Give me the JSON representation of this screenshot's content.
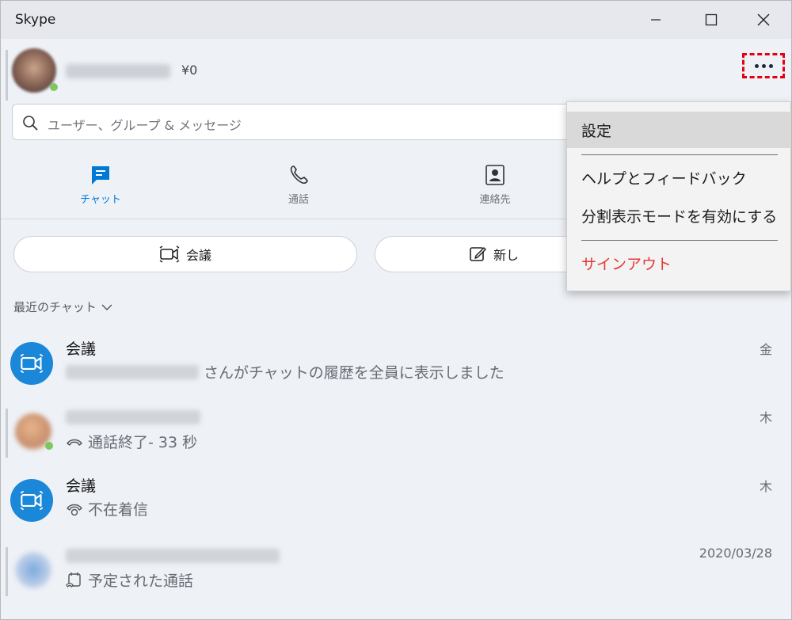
{
  "window": {
    "title": "Skype"
  },
  "profile": {
    "credit": "¥0"
  },
  "search": {
    "placeholder": "ユーザー、グループ & メッセージ"
  },
  "tabs": [
    {
      "label": "チャット",
      "icon": "chat-icon",
      "active": true
    },
    {
      "label": "通話",
      "icon": "phone-icon",
      "active": false
    },
    {
      "label": "連絡先",
      "icon": "contacts-icon",
      "active": false
    }
  ],
  "actions": {
    "meet_label": "会議",
    "new_label": "新し"
  },
  "recent": {
    "label": "最近のチャット"
  },
  "chats": [
    {
      "title": "会議",
      "subtitle": "さんがチャットの履歴を全員に表示しました",
      "time": "金",
      "avatar": "video-meeting-icon"
    },
    {
      "title": "",
      "subtitle": "通話終了- 33 秒",
      "time": "木",
      "avatar": "blurred-photo",
      "sub_icon": "hangup-icon"
    },
    {
      "title": "会議",
      "subtitle": "不在着信",
      "time": "木",
      "avatar": "video-meeting-icon",
      "sub_icon": "missed-call-icon"
    },
    {
      "title": "",
      "subtitle": "予定された通話",
      "time": "2020/03/28",
      "avatar": "blurred-photo",
      "sub_icon": "scheduled-call-icon"
    }
  ],
  "menu": {
    "items": [
      {
        "label": "設定",
        "hover": true
      },
      {
        "label": "ヘルプとフィードバック"
      },
      {
        "label": "分割表示モードを有効にする"
      },
      {
        "label": "サインアウト",
        "danger": true
      }
    ]
  },
  "colors": {
    "accent": "#0078d4",
    "meeting_avatar": "#1b87d9",
    "danger": "#e53935",
    "highlight_box": "#e60012"
  }
}
